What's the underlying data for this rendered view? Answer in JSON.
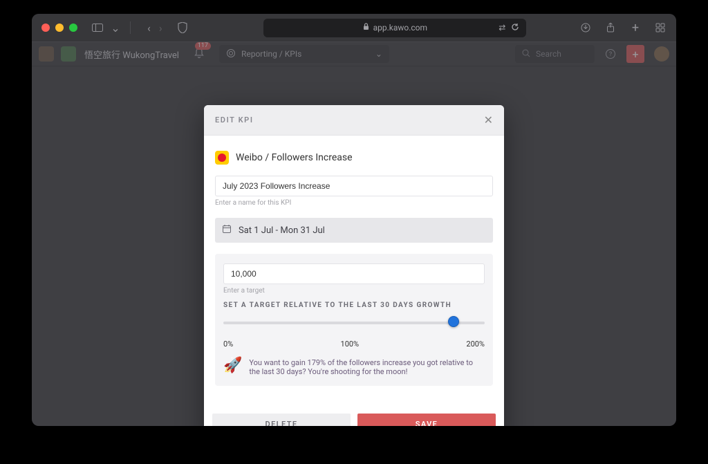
{
  "browser": {
    "url": "app.kawo.com"
  },
  "header": {
    "workspace": "悟空旅行 WukongTravel",
    "notification_count": "117",
    "breadcrumb": "Reporting / KPIs",
    "search_placeholder": "Search"
  },
  "modal": {
    "title": "EDIT KPI",
    "source": "Weibo / Followers Increase",
    "name_value": "July 2023 Followers Increase",
    "name_help": "Enter a name for this KPI",
    "date_range": "Sat 1 Jul - Mon 31 Jul",
    "target_value": "10,000",
    "target_help": "Enter a target",
    "relative_heading": "SET A TARGET RELATIVE TO THE LAST 30 DAYS GROWTH",
    "ticks": {
      "min": "0%",
      "mid": "100%",
      "max": "200%"
    },
    "slider_percent": 88,
    "rocket_text": "You want to gain 179% of the followers increase you got relative to the last 30 days? You're shooting for the moon!",
    "delete_label": "DELETE",
    "save_label": "SAVE"
  }
}
